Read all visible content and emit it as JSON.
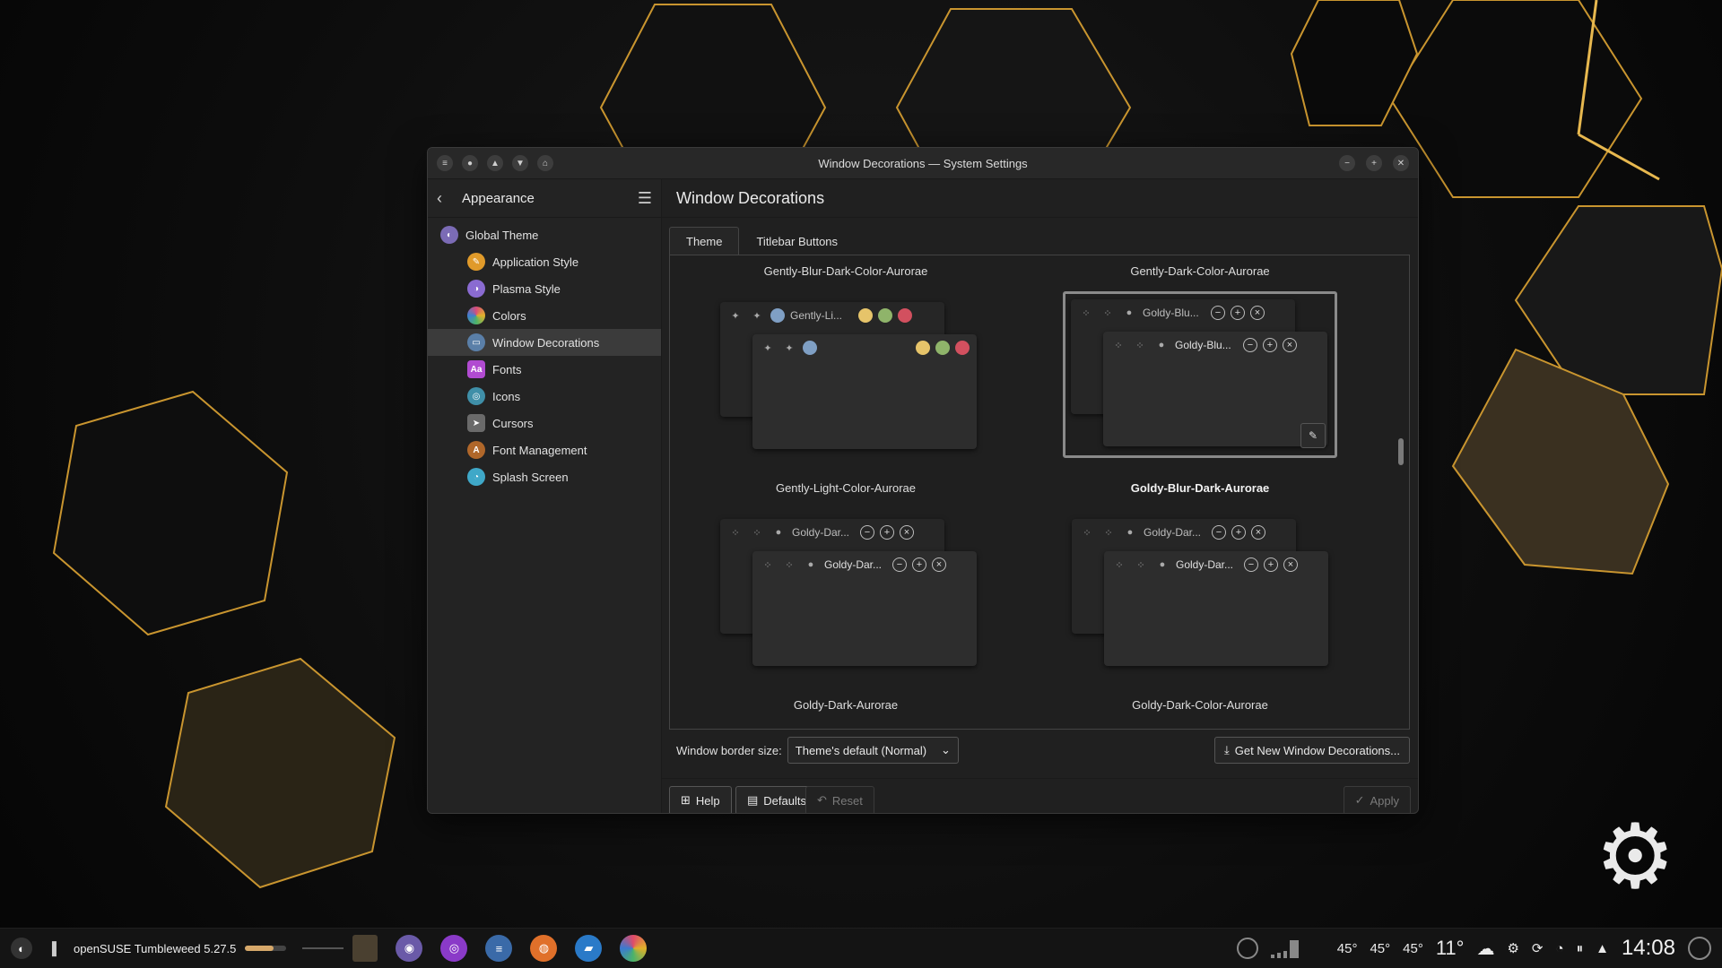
{
  "window": {
    "title": "Window Decorations — System Settings"
  },
  "sidebar": {
    "header": "Appearance",
    "items": [
      {
        "label": "Global Theme",
        "icon": "global-theme-icon",
        "color": "#7b6bb5"
      },
      {
        "label": "Application Style",
        "icon": "application-style-icon",
        "color": "#e09a2a"
      },
      {
        "label": "Plasma Style",
        "icon": "plasma-style-icon",
        "color": "#8a6bd1"
      },
      {
        "label": "Colors",
        "icon": "colors-icon",
        "color": "#d94b7a"
      },
      {
        "label": "Window Decorations",
        "icon": "window-decorations-icon",
        "color": "#5a7fa8"
      },
      {
        "label": "Fonts",
        "icon": "fonts-icon",
        "color": "#b14bd1",
        "glyph": "Aa"
      },
      {
        "label": "Icons",
        "icon": "icons-icon",
        "color": "#3f8fa8"
      },
      {
        "label": "Cursors",
        "icon": "cursors-icon",
        "color": "#6a6a6a"
      },
      {
        "label": "Font Management",
        "icon": "font-management-icon",
        "color": "#b0672a"
      },
      {
        "label": "Splash Screen",
        "icon": "splash-screen-icon",
        "color": "#3fa8c8"
      }
    ]
  },
  "main": {
    "title": "Window Decorations",
    "tabs": [
      "Theme",
      "Titlebar Buttons"
    ],
    "top_labels": [
      "Gently-Blur-Dark-Color-Aurorae",
      "Gently-Dark-Color-Aurorae"
    ],
    "decorations": [
      {
        "name": "Gently-Light-Color-Aurorae",
        "preview_title": "Gently-Li...",
        "style": "colored"
      },
      {
        "name": "Goldy-Blur-Dark-Aurorae",
        "preview_title": "Goldy-Blu...",
        "style": "symbols",
        "selected": true
      },
      {
        "name": "Goldy-Dark-Aurorae",
        "preview_title": "Goldy-Dar...",
        "style": "symbols"
      },
      {
        "name": "Goldy-Dark-Color-Aurorae",
        "preview_title": "Goldy-Dar...",
        "style": "symbols"
      }
    ],
    "border_size_label": "Window border size:",
    "border_size_value": "Theme's default (Normal)",
    "get_new": "Get New Window Decorations..."
  },
  "footer": {
    "help": "Help",
    "defaults": "Defaults",
    "reset": "Reset",
    "apply": "Apply"
  },
  "taskbar": {
    "os_label": "openSUSE Tumbleweed 5.27.5",
    "temps": [
      "45°",
      "45°",
      "45°"
    ],
    "weather": "11°",
    "clock": "14:08"
  },
  "colors": {
    "accent_gold": "#d4a84a",
    "dot_yellow": "#e6c46a",
    "dot_green": "#8fb46a",
    "dot_red": "#d2505f",
    "dot_blue": "#7f9fc4"
  }
}
